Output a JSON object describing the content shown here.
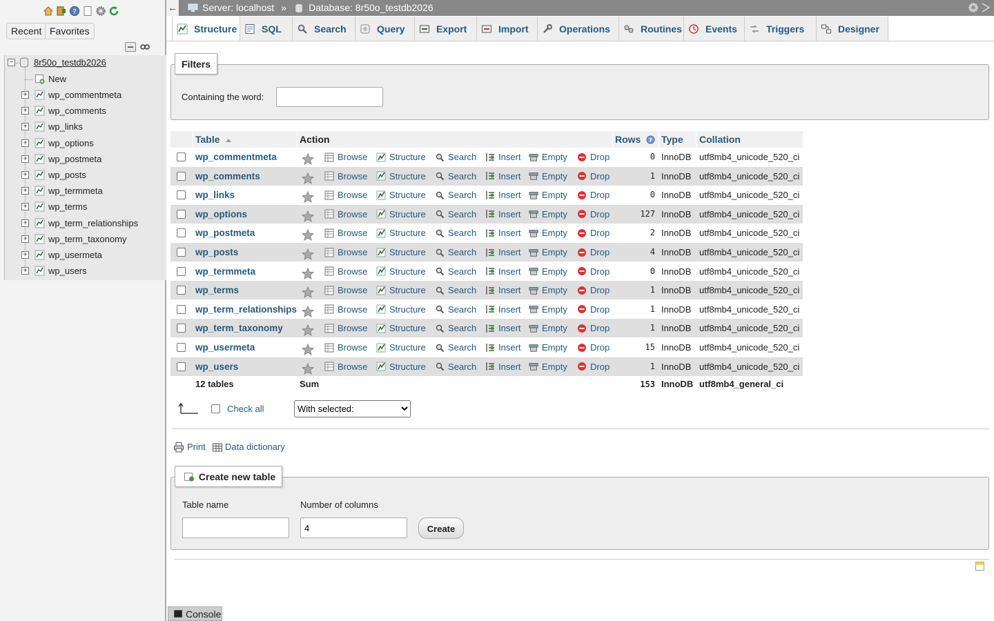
{
  "sidebar": {
    "recent_label": "Recent",
    "favorites_label": "Favorites",
    "db_name": "8r50o_testdb2026",
    "new_label": "New",
    "tables": [
      "wp_commentmeta",
      "wp_comments",
      "wp_links",
      "wp_options",
      "wp_postmeta",
      "wp_posts",
      "wp_termmeta",
      "wp_terms",
      "wp_term_relationships",
      "wp_term_taxonomy",
      "wp_usermeta",
      "wp_users"
    ]
  },
  "topbar": {
    "server": "Server: localhost",
    "separator": "»",
    "database": "Database: 8r50o_testdb2026"
  },
  "tabs": [
    "Structure",
    "SQL",
    "Search",
    "Query",
    "Export",
    "Import",
    "Operations",
    "Routines",
    "Events",
    "Triggers",
    "Designer"
  ],
  "filters": {
    "legend": "Filters",
    "containing_label": "Containing the word:",
    "containing_value": ""
  },
  "table": {
    "headers": {
      "table": "Table",
      "action": "Action",
      "rows": "Rows",
      "type": "Type",
      "collation": "Collation"
    },
    "actions": {
      "browse": "Browse",
      "structure": "Structure",
      "search": "Search",
      "insert": "Insert",
      "empty": "Empty",
      "drop": "Drop"
    },
    "rows": [
      {
        "name": "wp_commentmeta",
        "rows": "0",
        "type": "InnoDB",
        "collation": "utf8mb4_unicode_520_ci"
      },
      {
        "name": "wp_comments",
        "rows": "1",
        "type": "InnoDB",
        "collation": "utf8mb4_unicode_520_ci"
      },
      {
        "name": "wp_links",
        "rows": "0",
        "type": "InnoDB",
        "collation": "utf8mb4_unicode_520_ci"
      },
      {
        "name": "wp_options",
        "rows": "127",
        "type": "InnoDB",
        "collation": "utf8mb4_unicode_520_ci"
      },
      {
        "name": "wp_postmeta",
        "rows": "2",
        "type": "InnoDB",
        "collation": "utf8mb4_unicode_520_ci"
      },
      {
        "name": "wp_posts",
        "rows": "4",
        "type": "InnoDB",
        "collation": "utf8mb4_unicode_520_ci"
      },
      {
        "name": "wp_termmeta",
        "rows": "0",
        "type": "InnoDB",
        "collation": "utf8mb4_unicode_520_ci"
      },
      {
        "name": "wp_terms",
        "rows": "1",
        "type": "InnoDB",
        "collation": "utf8mb4_unicode_520_ci"
      },
      {
        "name": "wp_term_relationships",
        "rows": "1",
        "type": "InnoDB",
        "collation": "utf8mb4_unicode_520_ci"
      },
      {
        "name": "wp_term_taxonomy",
        "rows": "1",
        "type": "InnoDB",
        "collation": "utf8mb4_unicode_520_ci"
      },
      {
        "name": "wp_usermeta",
        "rows": "15",
        "type": "InnoDB",
        "collation": "utf8mb4_unicode_520_ci"
      },
      {
        "name": "wp_users",
        "rows": "1",
        "type": "InnoDB",
        "collation": "utf8mb4_unicode_520_ci"
      }
    ],
    "summary": {
      "count": "12 tables",
      "sum_label": "Sum",
      "rows": "153",
      "type": "InnoDB",
      "collation": "utf8mb4_general_ci"
    }
  },
  "bulk": {
    "check_all": "Check all",
    "with_selected": "With selected:"
  },
  "links": {
    "print": "Print",
    "data_dictionary": "Data dictionary"
  },
  "create_table": {
    "legend": "Create new table",
    "table_name_label": "Table name",
    "table_name_value": "",
    "num_columns_label": "Number of columns",
    "num_columns_value": "4",
    "create_button": "Create"
  },
  "console_label": "Console",
  "colors": {
    "link": "#235a81",
    "topbar": "#888888",
    "row_alt": "#dfdfdf",
    "drop_red": "#d33"
  }
}
